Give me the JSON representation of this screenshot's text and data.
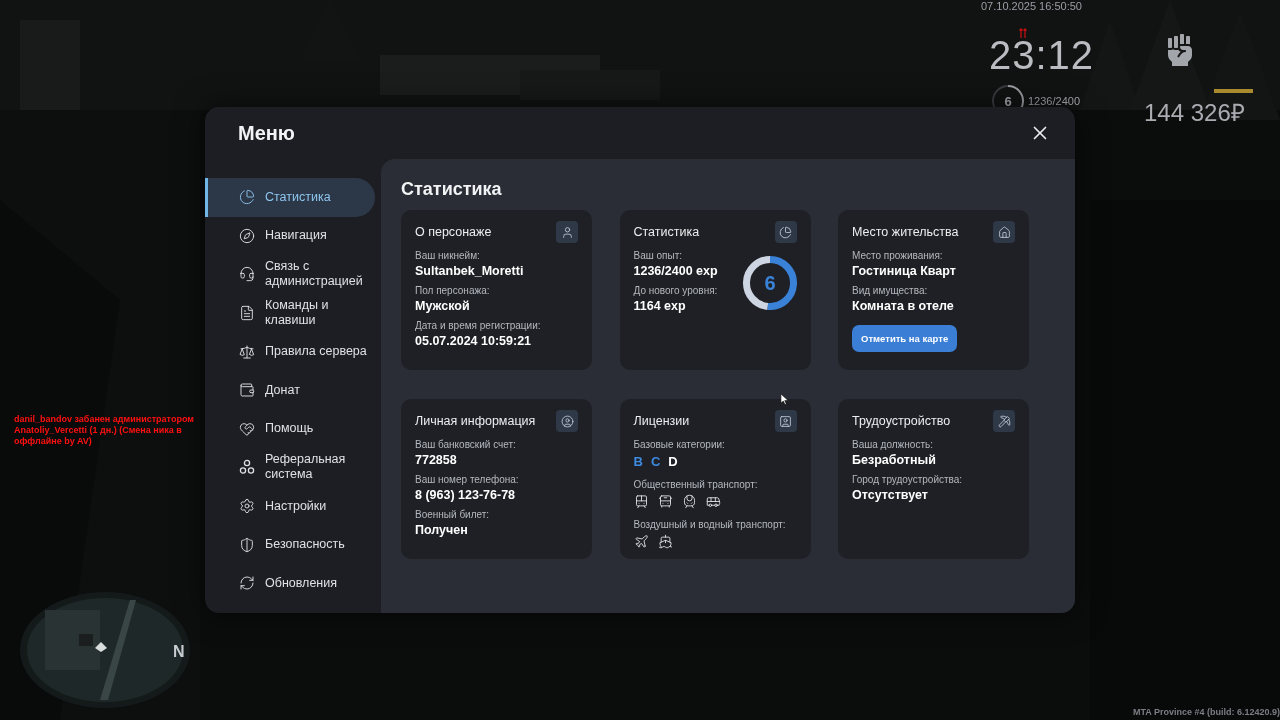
{
  "hud": {
    "datetime": "07.10.2025 16:50:50",
    "clock": "23:12",
    "level_badge": "6",
    "experience": {
      "text": "1236/2400",
      "level": 0.515
    },
    "money": "144 326₽",
    "compass": "N",
    "build": "MTA Province #4 (build: 6.12420.9)"
  },
  "chat": [
    "danil_bandov забанен администратором Anatoliy_Vercetti (1 дн.) (Смена ника в оффлайне by AV)"
  ],
  "menu": {
    "title": "Меню",
    "items": [
      {
        "label": "Статистика",
        "selected": true
      },
      {
        "label": "Навигация",
        "selected": false
      },
      {
        "label": "Связь с администрацией",
        "selected": false
      },
      {
        "label": "Команды и клавиши",
        "selected": false
      },
      {
        "label": "Правила сервера",
        "selected": false
      },
      {
        "label": "Донат",
        "selected": false
      },
      {
        "label": "Помощь",
        "selected": false
      },
      {
        "label": "Реферальная система",
        "selected": false
      },
      {
        "label": "Настройки",
        "selected": false
      },
      {
        "label": "Безопасность",
        "selected": false
      },
      {
        "label": "Обновления",
        "selected": false
      }
    ]
  },
  "content": {
    "title": "Статистика",
    "cards": [
      {
        "kind": "info",
        "title": "О персонаже",
        "fields": [
          {
            "label": "Ваш никнейм:",
            "value": "Sultanbek_Moretti"
          },
          {
            "label": "Пол персонажа:",
            "value": "Мужской"
          },
          {
            "label": "Дата и время регистрации:",
            "value": "05.07.2024 10:59:21"
          }
        ]
      },
      {
        "kind": "stats",
        "title": "Статистика",
        "fields": [
          {
            "label": "Ваш опыт:",
            "value": "1236/2400 exp"
          },
          {
            "label": "До нового уровня:",
            "value": "1164 exp"
          }
        ],
        "ring": {
          "text": "6",
          "level": 0.515
        }
      },
      {
        "kind": "residence",
        "title": "Место жительства",
        "fields": [
          {
            "label": "Место проживания:",
            "value": "Гостиница Кварт"
          },
          {
            "label": "Вид имущества:",
            "value": "Комната в отеле"
          }
        ],
        "button": "Отметить на карте"
      },
      {
        "kind": "info",
        "title": "Личная информация",
        "fields": [
          {
            "label": "Ваш банковский счет:",
            "value": "772858"
          },
          {
            "label": "Ваш номер телефона:",
            "value": "8 (963) 123-76-78"
          },
          {
            "label": "Военный билет:",
            "value": "Получен"
          }
        ]
      },
      {
        "kind": "licenses",
        "title": "Лицензии",
        "sections": [
          {
            "kind": "categories",
            "label": "Базовые категории:",
            "categories": [
              {
                "text": "B",
                "active": true
              },
              {
                "text": "C",
                "active": true
              },
              {
                "text": "D",
                "active": false
              }
            ]
          },
          {
            "kind": "transport",
            "label": "Общественный транспорт:"
          },
          {
            "kind": "transport",
            "label": "Воздушный и водный транспорт:"
          }
        ]
      },
      {
        "kind": "info",
        "title": "Трудоустройство",
        "fields": [
          {
            "label": "Ваша должность:",
            "value": "Безработный"
          },
          {
            "label": "Город трудоустройства:",
            "value": "Отсутствует"
          }
        ]
      }
    ]
  }
}
